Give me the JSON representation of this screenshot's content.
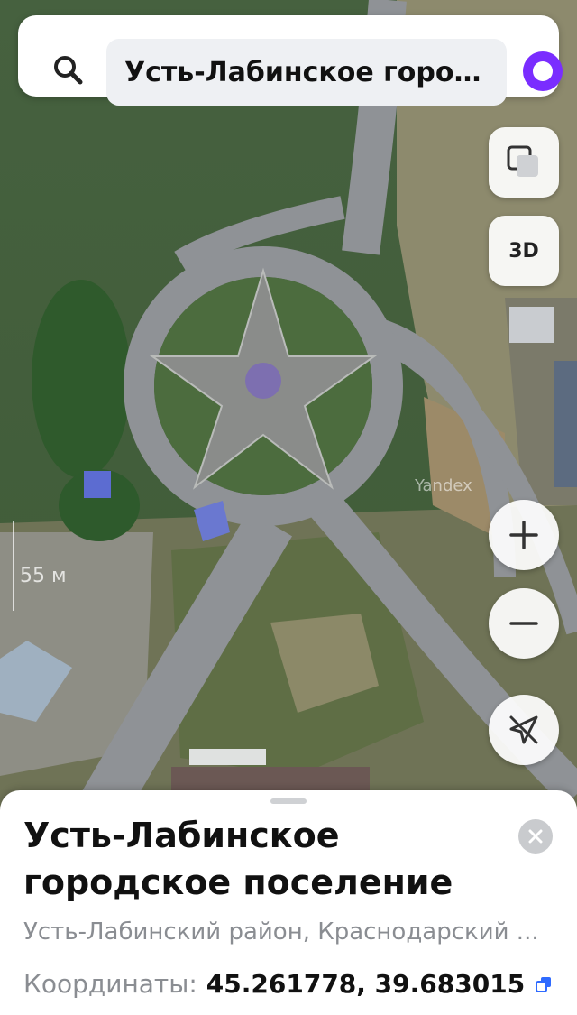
{
  "search": {
    "query": "Усть-Лабинское город..."
  },
  "map": {
    "scale_label": "55 м",
    "watermark": "Yandex"
  },
  "controls": {
    "layers_icon": "layers-icon",
    "btn_3d": "3D",
    "zoom_in": "+",
    "zoom_out": "−",
    "location_icon": "navigation-off-icon"
  },
  "card": {
    "title": "Усть-Лабинское городское поселение",
    "subtitle": "Усть-Лабинский район, Краснодарский ...",
    "coords_label": "Координаты:",
    "coords_value": "45.261778, 39.683015"
  },
  "colors": {
    "accent": "#7a2dff",
    "copy": "#2f6bff"
  }
}
